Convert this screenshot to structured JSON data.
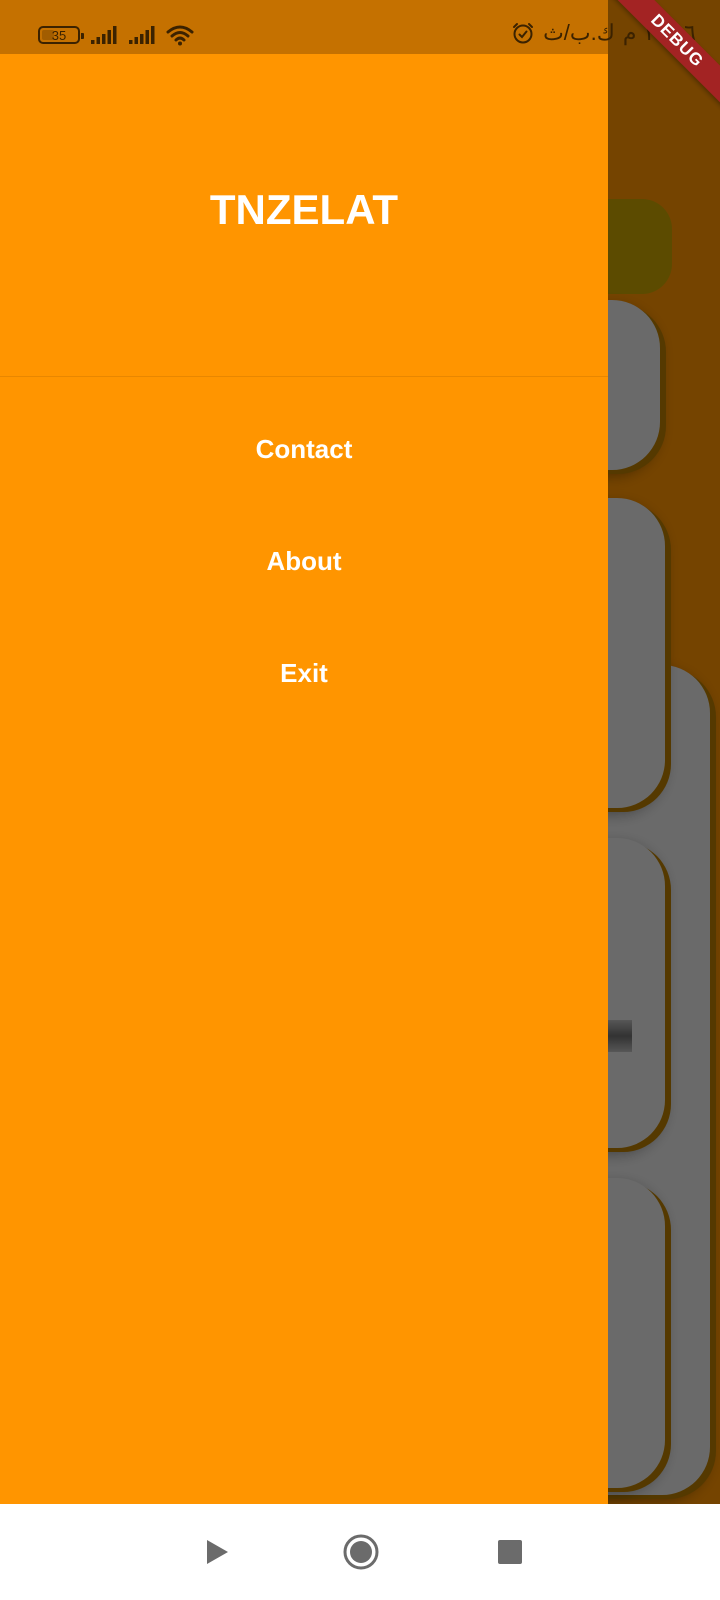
{
  "status_bar": {
    "battery": "35",
    "clock": "١٠:٠٦ م",
    "network": "ك.ب/ث",
    "icons": [
      "battery-icon",
      "signal-icon",
      "signal-icon",
      "wifi-icon",
      "alarm-icon"
    ]
  },
  "debug_banner": "DEBUG",
  "drawer": {
    "title": "TNZELAT",
    "items": [
      {
        "label": "Contact"
      },
      {
        "label": "About"
      },
      {
        "label": "Exit"
      }
    ]
  },
  "nav_bar": {
    "icons": [
      "back-icon",
      "home-icon",
      "recents-icon"
    ]
  },
  "colors": {
    "drawer_bg": "#ff9500",
    "status_bar_shade": "#c57100",
    "scrim": "rgba(0,0,0,0.54)",
    "debug_ribbon": "#a32323",
    "text_on_drawer": "#ffffff",
    "nav_bar_bg": "#ffffff"
  }
}
